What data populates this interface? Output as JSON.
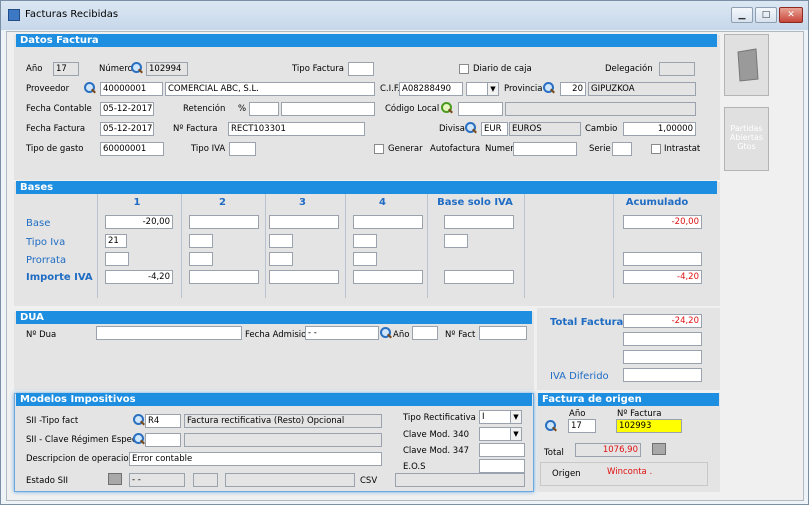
{
  "window": {
    "title": "Facturas Recibidas",
    "min": "▁",
    "max": "□",
    "close": "✕"
  },
  "datos": {
    "header": "Datos Factura",
    "anio_label": "Año",
    "anio": "17",
    "numero_label": "Número",
    "numero": "102994",
    "tipo_factura_label": "Tipo Factura",
    "diario_caja_label": "Diario de caja",
    "delegacion_label": "Delegación",
    "proveedor_label": "Proveedor",
    "proveedor_code": "40000001",
    "proveedor_name": "COMERCIAL ABC, S.L.",
    "cif_label": "C.I.F.",
    "cif": "A08288490",
    "provincia_label": "Provincia",
    "provincia_code": "20",
    "provincia_name": "GIPUZKOA",
    "fecha_contable_label": "Fecha Contable",
    "fecha_contable": "05-12-2017",
    "retencion_label": "Retención",
    "pct_label": "%",
    "codigo_local_label": "Código Local",
    "fecha_factura_label": "Fecha Factura",
    "fecha_factura": "05-12-2017",
    "nfactura_label": "Nº Factura",
    "nfactura": "RECT103301",
    "divisa_label": "Divisa",
    "divisa_code": "EUR",
    "divisa_name": "EUROS",
    "cambio_label": "Cambio",
    "cambio": "1,00000",
    "tipo_gasto_label": "Tipo de gasto",
    "tipo_gasto": "60000001",
    "tipo_iva_label": "Tipo IVA",
    "generar_label": "Generar",
    "autofactura_label": "Autofactura",
    "numero2_label": "Numero",
    "serie_label": "Serie",
    "intrastat_label": "Intrastat"
  },
  "bases": {
    "header": "Bases",
    "cols": [
      "1",
      "2",
      "3",
      "4",
      "Base solo IVA",
      "Acumulado"
    ],
    "row_base": "Base",
    "row_tipo": "Tipo Iva",
    "row_prorrata": "Prorrata",
    "row_importe": "Importe IVA",
    "base1": "-20,00",
    "tipo1": "21",
    "importe1": "-4,20",
    "acum_base": "-20,00",
    "acum_importe": "-4,20"
  },
  "dua": {
    "header": "DUA",
    "ndua_label": "Nº Dua",
    "fecha_adm_label": "Fecha Admision",
    "fecha_adm": "-  -",
    "anio_label": "Año",
    "nfact_label": "Nº Fact"
  },
  "totales": {
    "total_label": "Total Factura",
    "total": "-24,20",
    "iva_diferido_label": "IVA Diferido"
  },
  "modelos": {
    "header": "Modelos Impositivos",
    "sii_tipo_label": "SII -Tipo fact",
    "sii_tipo_code": "R4",
    "sii_tipo_desc": "Factura rectificativa (Resto) Opcional",
    "sii_clave_label": "SII - Clave Régimen Especial",
    "desc_op_label": "Descripcion de operacion",
    "desc_op": "Error contable",
    "estado_label": "Estado SII",
    "estado_val": "-  -",
    "csv_label": "CSV",
    "tipo_rect_label": "Tipo Rectificativa",
    "tipo_rect": "I",
    "clave340_label": "Clave Mod. 340",
    "clave347_label": "Clave Mod. 347",
    "eos_label": "E.O.S"
  },
  "origen": {
    "header": "Factura de origen",
    "anio_label": "Año",
    "anio": "17",
    "nfactura_label": "Nº Factura",
    "nfactura": "102993",
    "total_label": "Total",
    "total": "1076,90",
    "origen_label": "Origen",
    "origen_val": "Winconta  ."
  },
  "side": {
    "btn2_label": "Partidas Abiertas Gtos"
  }
}
